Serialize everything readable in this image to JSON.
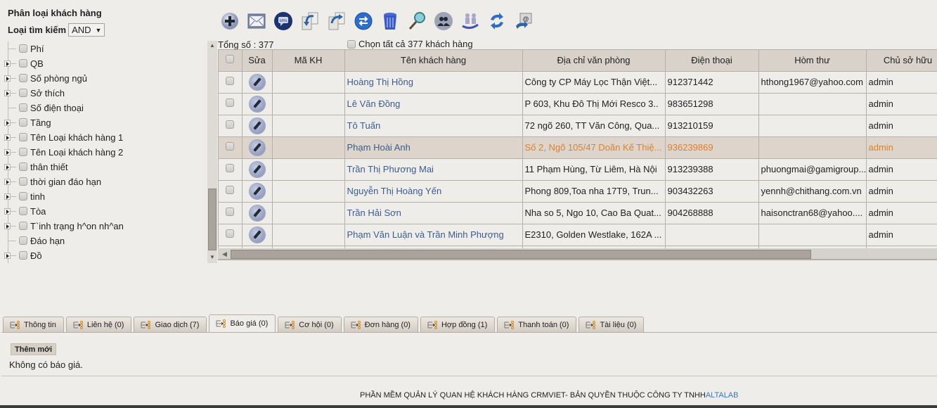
{
  "sidebar": {
    "title": "Phân loại khách hàng",
    "search_type_label": "Loại tìm kiếm",
    "search_type_value": "AND",
    "tree": [
      {
        "label": "Phí",
        "expandable": false
      },
      {
        "label": "QB",
        "expandable": true
      },
      {
        "label": "Số phòng ngủ",
        "expandable": true
      },
      {
        "label": "Sở thích",
        "expandable": true
      },
      {
        "label": "Số điện thoại",
        "expandable": false
      },
      {
        "label": "Tầng",
        "expandable": true
      },
      {
        "label": "Tên Loại khách hàng 1",
        "expandable": true
      },
      {
        "label": "Tên Loại khách hàng 2",
        "expandable": true
      },
      {
        "label": "thân thiết",
        "expandable": true
      },
      {
        "label": "thời gian đáo hạn",
        "expandable": true
      },
      {
        "label": "tinh",
        "expandable": true
      },
      {
        "label": "Tòa",
        "expandable": true
      },
      {
        "label": "T`inh trạng h^on nh^an",
        "expandable": true
      },
      {
        "label": "Đáo hạn",
        "expandable": false
      },
      {
        "label": "Đồ",
        "expandable": true
      }
    ]
  },
  "toolbar": {
    "buttons": [
      {
        "name": "add-icon"
      },
      {
        "name": "email-icon"
      },
      {
        "name": "sms-icon"
      },
      {
        "name": "import-icon"
      },
      {
        "name": "export-icon"
      },
      {
        "name": "transfer-icon"
      },
      {
        "name": "trash-icon"
      },
      {
        "name": "search-icon"
      },
      {
        "name": "group-icon"
      },
      {
        "name": "meeting-icon"
      },
      {
        "name": "refresh-icon"
      },
      {
        "name": "email-send-icon"
      }
    ]
  },
  "grid": {
    "total_label": "Tổng số : 377",
    "select_all_label": "Chọn tất cả 377 khách hàng",
    "columns": [
      "",
      "Sửa",
      "Mã KH",
      "Tên khách hàng",
      "Địa chỉ văn phòng",
      "Điện thoại",
      "Hòm thư",
      "Chủ sở hữu"
    ],
    "rows": [
      {
        "code": "",
        "name": "Hoàng Thị Hồng",
        "address": "Công ty CP Máy Lọc Thận Việt...",
        "phone": "912371442",
        "email": "hthong1967@yahoo.com",
        "owner": "admin",
        "selected": false
      },
      {
        "code": "",
        "name": "Lê Văn Đồng",
        "address": "P 603, Khu Đô Thị Mới Resco 3..",
        "phone": "983651298",
        "email": "",
        "owner": "admin",
        "selected": false
      },
      {
        "code": "",
        "name": "Tô Tuấn",
        "address": "72 ngõ 260, TT Văn Công, Qua...",
        "phone": "913210159",
        "email": "",
        "owner": "admin",
        "selected": false
      },
      {
        "code": "",
        "name": "Phạm Hoài Anh",
        "address": "Số 2, Ngõ 105/47 Doãn Kế Thiệ...",
        "phone": "936239869",
        "email": "",
        "owner": "admin",
        "selected": true
      },
      {
        "code": "",
        "name": "Trần Thị Phương Mai",
        "address": "11 Phạm Hùng, Từ Liêm, Hà Nội",
        "phone": "913239388",
        "email": "phuongmai@gamigroup...",
        "owner": "admin",
        "selected": false
      },
      {
        "code": "",
        "name": "Nguyễn Thị Hoàng Yến",
        "address": "Phong 809,Toa nha 17T9, Trun...",
        "phone": "903432263",
        "email": "yennh@chithang.com.vn",
        "owner": "admin",
        "selected": false
      },
      {
        "code": "",
        "name": "Trần Hải Sơn",
        "address": "Nha so 5, Ngo 10, Cao Ba Quat...",
        "phone": "904268888",
        "email": "haisonctran68@yahoo....",
        "owner": "admin",
        "selected": false
      },
      {
        "code": "",
        "name": "Phạm Văn Luận và Trần Minh Phượng",
        "address": "E2310, Golden Westlake, 162A ...",
        "phone": "",
        "email": "",
        "owner": "admin",
        "selected": false
      }
    ]
  },
  "tabs": {
    "items": [
      {
        "label": "Thông tin",
        "active": false
      },
      {
        "label": "Liên hệ (0)",
        "active": false
      },
      {
        "label": "Giao dịch (7)",
        "active": false
      },
      {
        "label": "Báo giá (0)",
        "active": true
      },
      {
        "label": "Cơ hội (0)",
        "active": false
      },
      {
        "label": "Đơn hàng (0)",
        "active": false
      },
      {
        "label": "Hợp đồng (1)",
        "active": false
      },
      {
        "label": "Thanh toán (0)",
        "active": false
      },
      {
        "label": "Tài liệu (0)",
        "active": false
      }
    ],
    "add_button": "Thêm mới",
    "empty_message": "Không có báo giá."
  },
  "footer": {
    "text": "PHẦN MỀM QUẢN LÝ QUAN HỆ KHÁCH HÀNG  CRMVIET- BẢN QUYỀN THUỘC CÔNG TY TNHH",
    "brand": "ALTALAB"
  },
  "colors": {
    "background": "#efedea",
    "header_bg": "#d8d2ca",
    "selected_row_bg": "#ddd5cb",
    "selected_row_text": "#e07f2c",
    "link": "#3b5c8f",
    "brand": "#3a78b5"
  }
}
